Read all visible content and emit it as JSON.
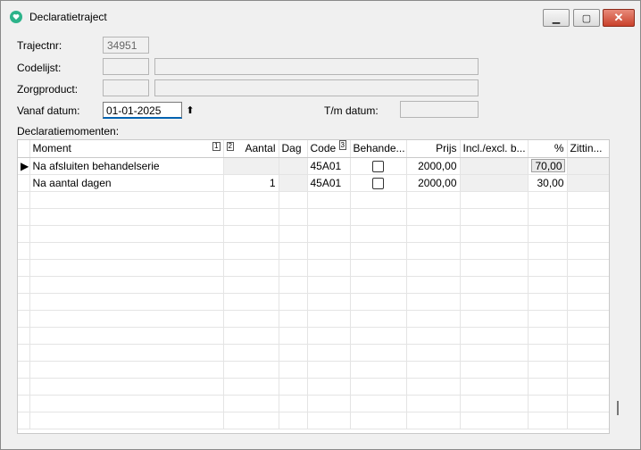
{
  "window": {
    "title": "Declaratietraject"
  },
  "form": {
    "trajectnr_label": "Trajectnr:",
    "trajectnr_value": "34951",
    "codelijst_label": "Codelijst:",
    "zorgproduct_label": "Zorgproduct:",
    "vanaf_label": "Vanaf datum:",
    "vanaf_value": "01-01-2025",
    "tm_label": "T/m datum:",
    "section_label": "Declaratiemomenten:"
  },
  "grid": {
    "headers": {
      "moment": "Moment",
      "moment_sort": "1",
      "aantal_sort": "2",
      "aantal": "Aantal",
      "dag": "Dag",
      "code": "Code",
      "code_sort": "3",
      "behandel": "Behande...",
      "prijs": "Prijs",
      "incl": "Incl./excl. b...",
      "pct": "%",
      "zitting": "Zittin..."
    },
    "rows": [
      {
        "moment": "Na afsluiten behandelserie",
        "aantal": "",
        "dag": "",
        "code": "45A01",
        "prijs": "2000,00",
        "incl": "",
        "pct": "70,00",
        "zitting": ""
      },
      {
        "moment": "Na aantal dagen",
        "aantal": "1",
        "dag": "",
        "code": "45A01",
        "prijs": "2000,00",
        "incl": "",
        "pct": "30,00",
        "zitting": ""
      }
    ]
  }
}
